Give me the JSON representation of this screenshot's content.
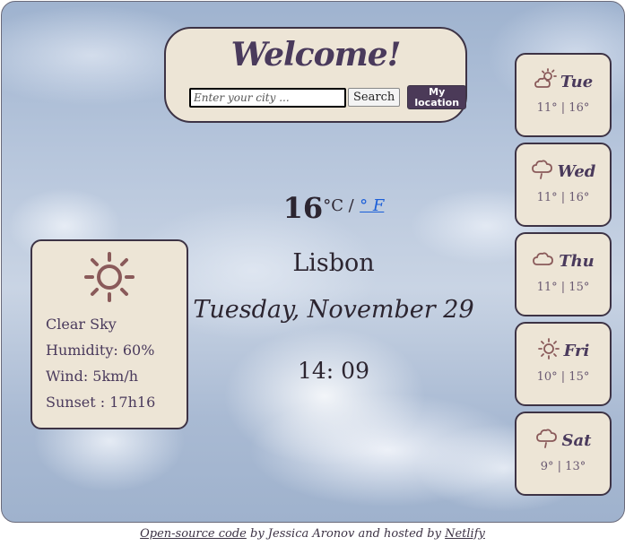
{
  "header": {
    "title": "Welcome!",
    "search_placeholder": "Enter your city ...",
    "search_label": "Search",
    "location_label_line1": "My",
    "location_label_line2": "location"
  },
  "current": {
    "temperature": "16",
    "unit_c": "°C /",
    "unit_f": "° F",
    "city": "Lisbon",
    "date": "Tuesday, November 29",
    "time": "14: 09"
  },
  "details": {
    "icon": "sun-icon",
    "condition": "Clear Sky",
    "humidity": "Humidity: 60%",
    "wind": "Wind: 5km/h",
    "sunset": "Sunset : 17h16"
  },
  "forecast": [
    {
      "day": "Tue",
      "temps": "11° | 16°",
      "icon": "partly-cloudy-icon"
    },
    {
      "day": "Wed",
      "temps": "11° | 16°",
      "icon": "rain-cloud-icon"
    },
    {
      "day": "Thu",
      "temps": "11° | 15°",
      "icon": "cloud-icon"
    },
    {
      "day": "Fri",
      "temps": "10° | 15°",
      "icon": "sun-icon"
    },
    {
      "day": "Sat",
      "temps": "9° | 13°",
      "icon": "rain-cloud-icon"
    }
  ],
  "footer": {
    "link1": "Open-source code",
    "text1": " by Jessica Aronov and hosted by ",
    "link2": "Netlify"
  },
  "colors": {
    "card_bg": "#ede5d6",
    "border": "#3d3345",
    "accent": "#4b3a58",
    "icon": "#8a5a5a"
  }
}
